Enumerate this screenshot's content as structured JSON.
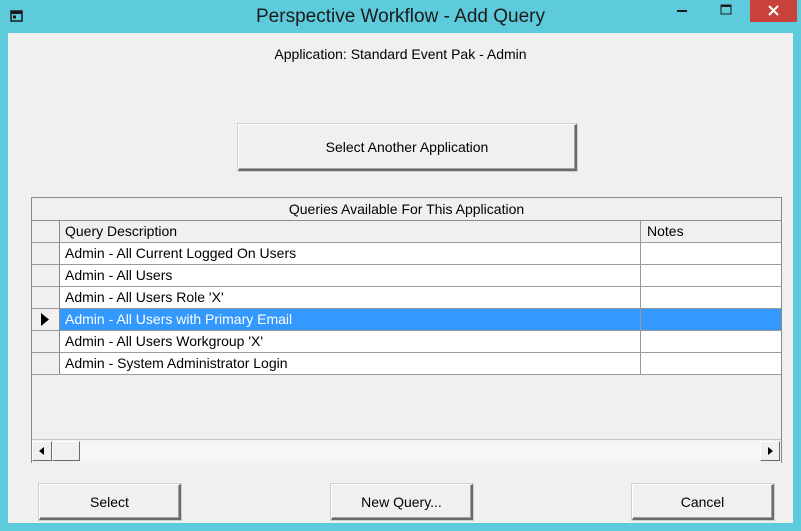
{
  "window": {
    "title": "Perspective Workflow - Add Query",
    "accent_color": "#5ecbdc",
    "close_color": "#c8413a"
  },
  "application": {
    "label": "Application:  Standard Event Pak - Admin"
  },
  "buttons": {
    "select_another_application": "Select Another Application",
    "select": "Select",
    "new_query": "New Query...",
    "cancel": "Cancel"
  },
  "grid": {
    "caption": "Queries Available For This Application",
    "columns": [
      "Query Description",
      "Notes"
    ],
    "rows": [
      {
        "description": "Admin - All Current Logged On Users",
        "notes": ""
      },
      {
        "description": "Admin - All Users",
        "notes": ""
      },
      {
        "description": "Admin - All Users Role 'X'",
        "notes": ""
      },
      {
        "description": "Admin - All Users with Primary Email",
        "notes": "",
        "selected": true
      },
      {
        "description": "Admin - All Users Workgroup 'X'",
        "notes": ""
      },
      {
        "description": "Admin - System Administrator Login",
        "notes": ""
      }
    ],
    "selection_color": "#3399ff"
  },
  "icons": {
    "app_icon": "window-app-icon",
    "minimize": "minimize-icon",
    "maximize": "maximize-icon",
    "close": "close-icon",
    "row_pointer": "row-pointer-icon",
    "scroll_left": "arrow-left-icon",
    "scroll_right": "arrow-right-icon"
  }
}
